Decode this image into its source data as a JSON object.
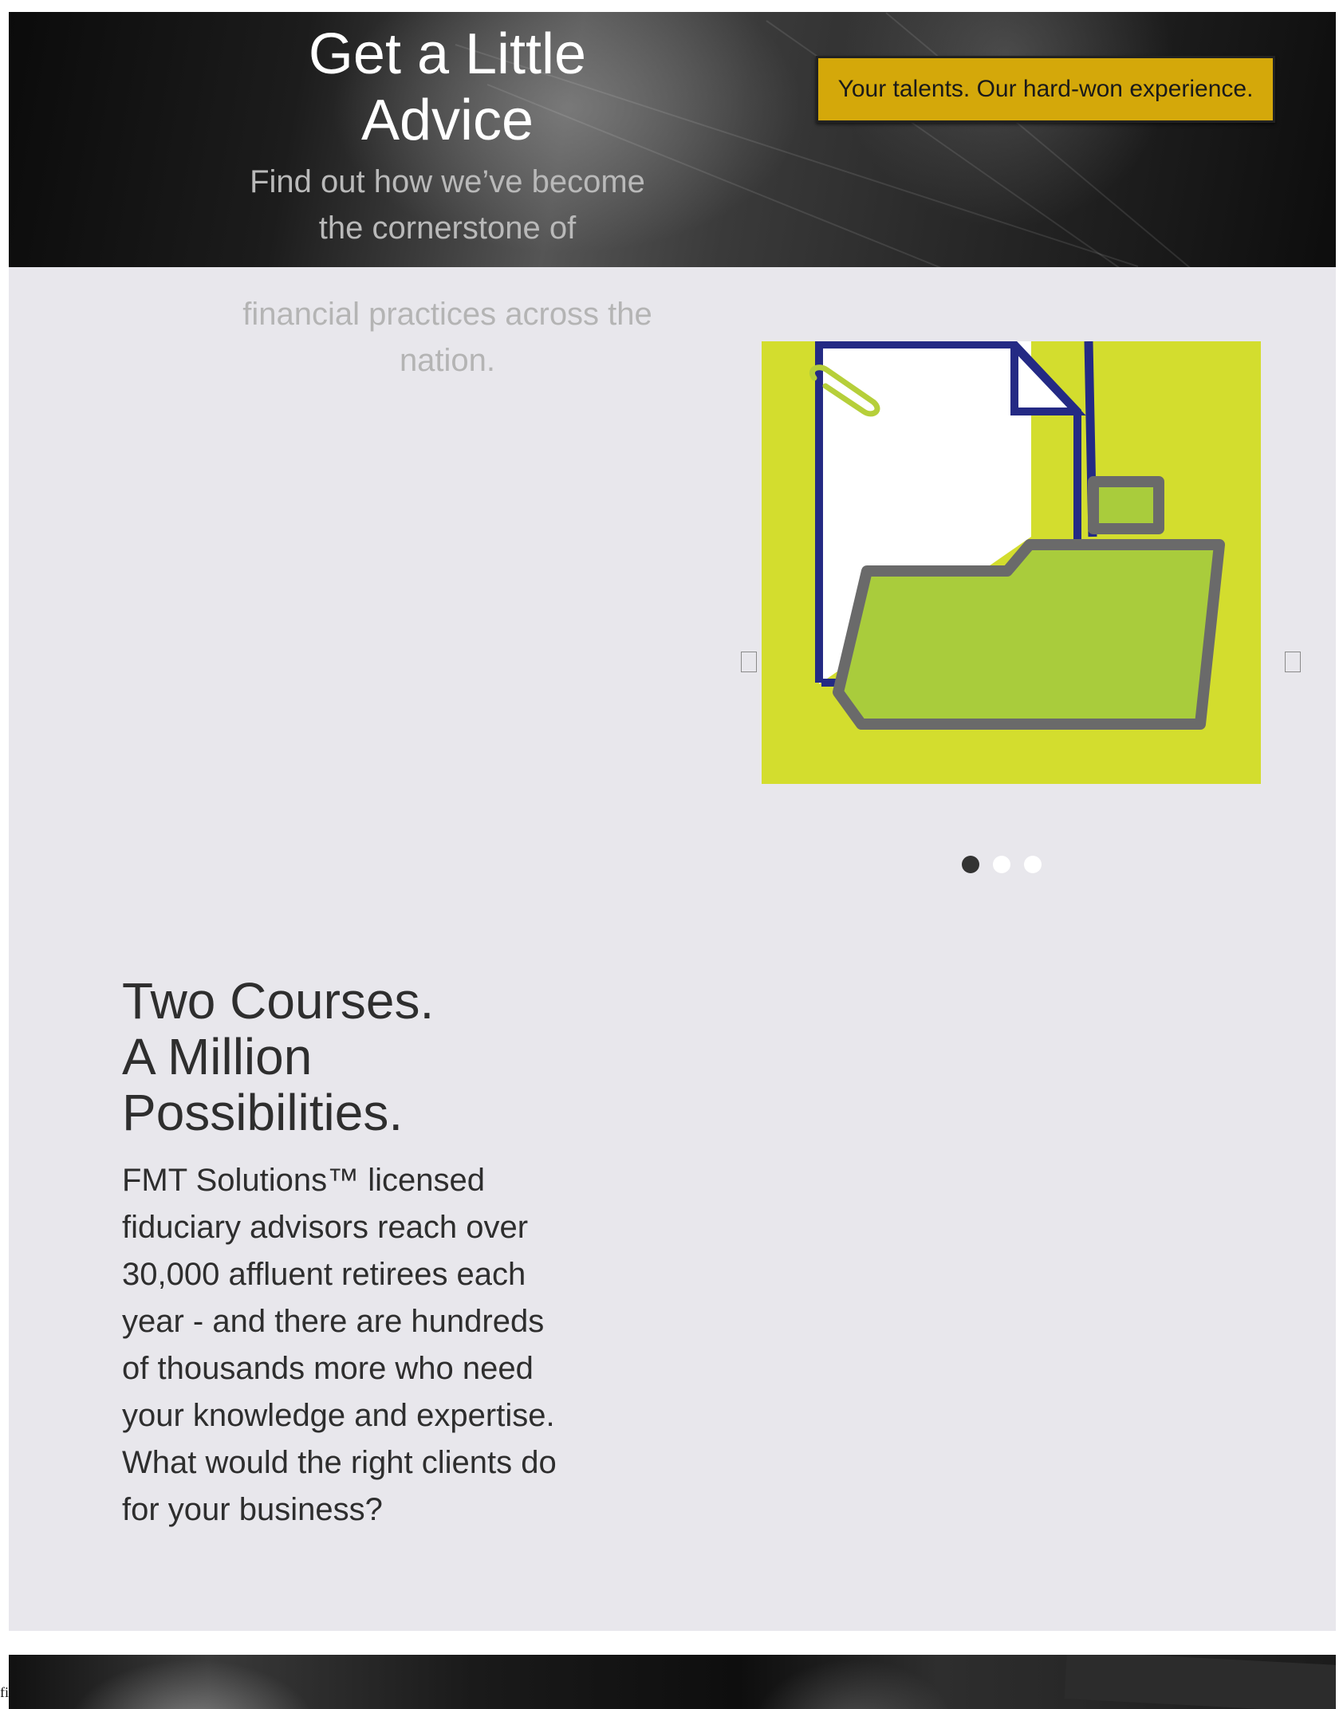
{
  "hero": {
    "title": "Get a Little Advice",
    "subtitle_first": "Find out how we’ve become the cornerstone of",
    "subtitle_cont": "financial practices across the nation.",
    "cta_label": "Your talents. Our hard-won experience."
  },
  "colors": {
    "accent": "#d4a80a",
    "slide_bg": "#d3dd2e",
    "folder_green": "#a9cc3c",
    "doc_outline": "#242a84",
    "section_bg": "#e8e7ec"
  },
  "carousel": {
    "slide_count": 3,
    "active_index": 0,
    "icons": [
      "document-icon",
      "paperclip-icon",
      "folder-icon"
    ],
    "prev_icon": "chevron-left-icon",
    "next_icon": "chevron-right-icon"
  },
  "courses": {
    "title_lines": [
      "Two Courses.",
      "A Million",
      "Possibilities."
    ],
    "body": "FMT Solutions™ licensed fiduciary advisors reach over 30,000 affluent retirees each year - and there are hundreds of thousands more who need your knowledge and expertise. What would the right clients do for your business?"
  },
  "footer": {
    "stray_text": "fi"
  }
}
